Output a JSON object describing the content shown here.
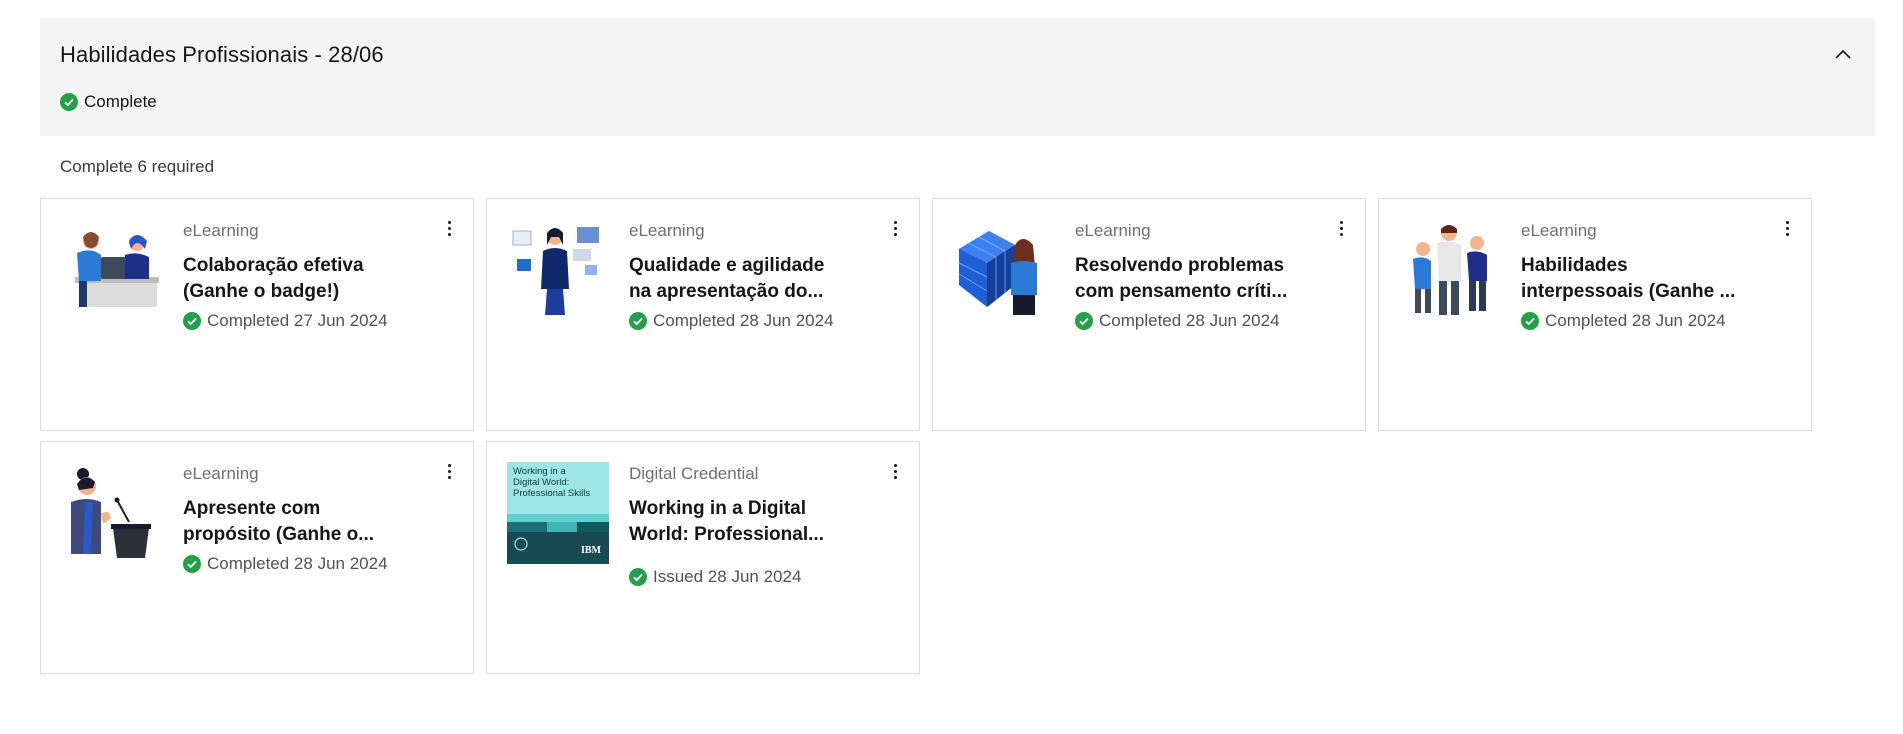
{
  "section": {
    "title": "Habilidades Profissionais - 28/06",
    "status": "Complete",
    "required_text": "Complete 6 required"
  },
  "colors": {
    "header_bg": "#f4f4f4",
    "success_green": "#24a148",
    "card_border": "#dcdcdc"
  },
  "cards": [
    {
      "type": "eLearning",
      "title_line1": "Colaboração efetiva",
      "title_line2": "(Ganhe o badge!)",
      "status": "Completed 27 Jun 2024",
      "thumbnail": "collaboration-illustration"
    },
    {
      "type": "eLearning",
      "title_line1": "Qualidade e agilidade",
      "title_line2": "na apresentação do...",
      "status": "Completed 28 Jun 2024",
      "thumbnail": "presentation-illustration"
    },
    {
      "type": "eLearning",
      "title_line1": "Resolvendo problemas",
      "title_line2": "com pensamento críti...",
      "status": "Completed 28 Jun 2024",
      "thumbnail": "cube-illustration"
    },
    {
      "type": "eLearning",
      "title_line1": "Habilidades",
      "title_line2": "interpessoais (Ganhe ...",
      "status": "Completed 28 Jun 2024",
      "thumbnail": "team-illustration"
    },
    {
      "type": "eLearning",
      "title_line1": "Apresente com",
      "title_line2": "propósito (Ganhe o...",
      "status": "Completed 28 Jun 2024",
      "thumbnail": "speaker-illustration"
    },
    {
      "type": "Digital Credential",
      "title_line1": "Working in a Digital",
      "title_line2": "World: Professional...",
      "status": "Issued 28 Jun 2024",
      "thumbnail": "credential-badge",
      "badge_text_1": "Working in a",
      "badge_text_2": "Digital World:",
      "badge_text_3": "Professional Skills",
      "badge_brand": "IBM"
    }
  ]
}
